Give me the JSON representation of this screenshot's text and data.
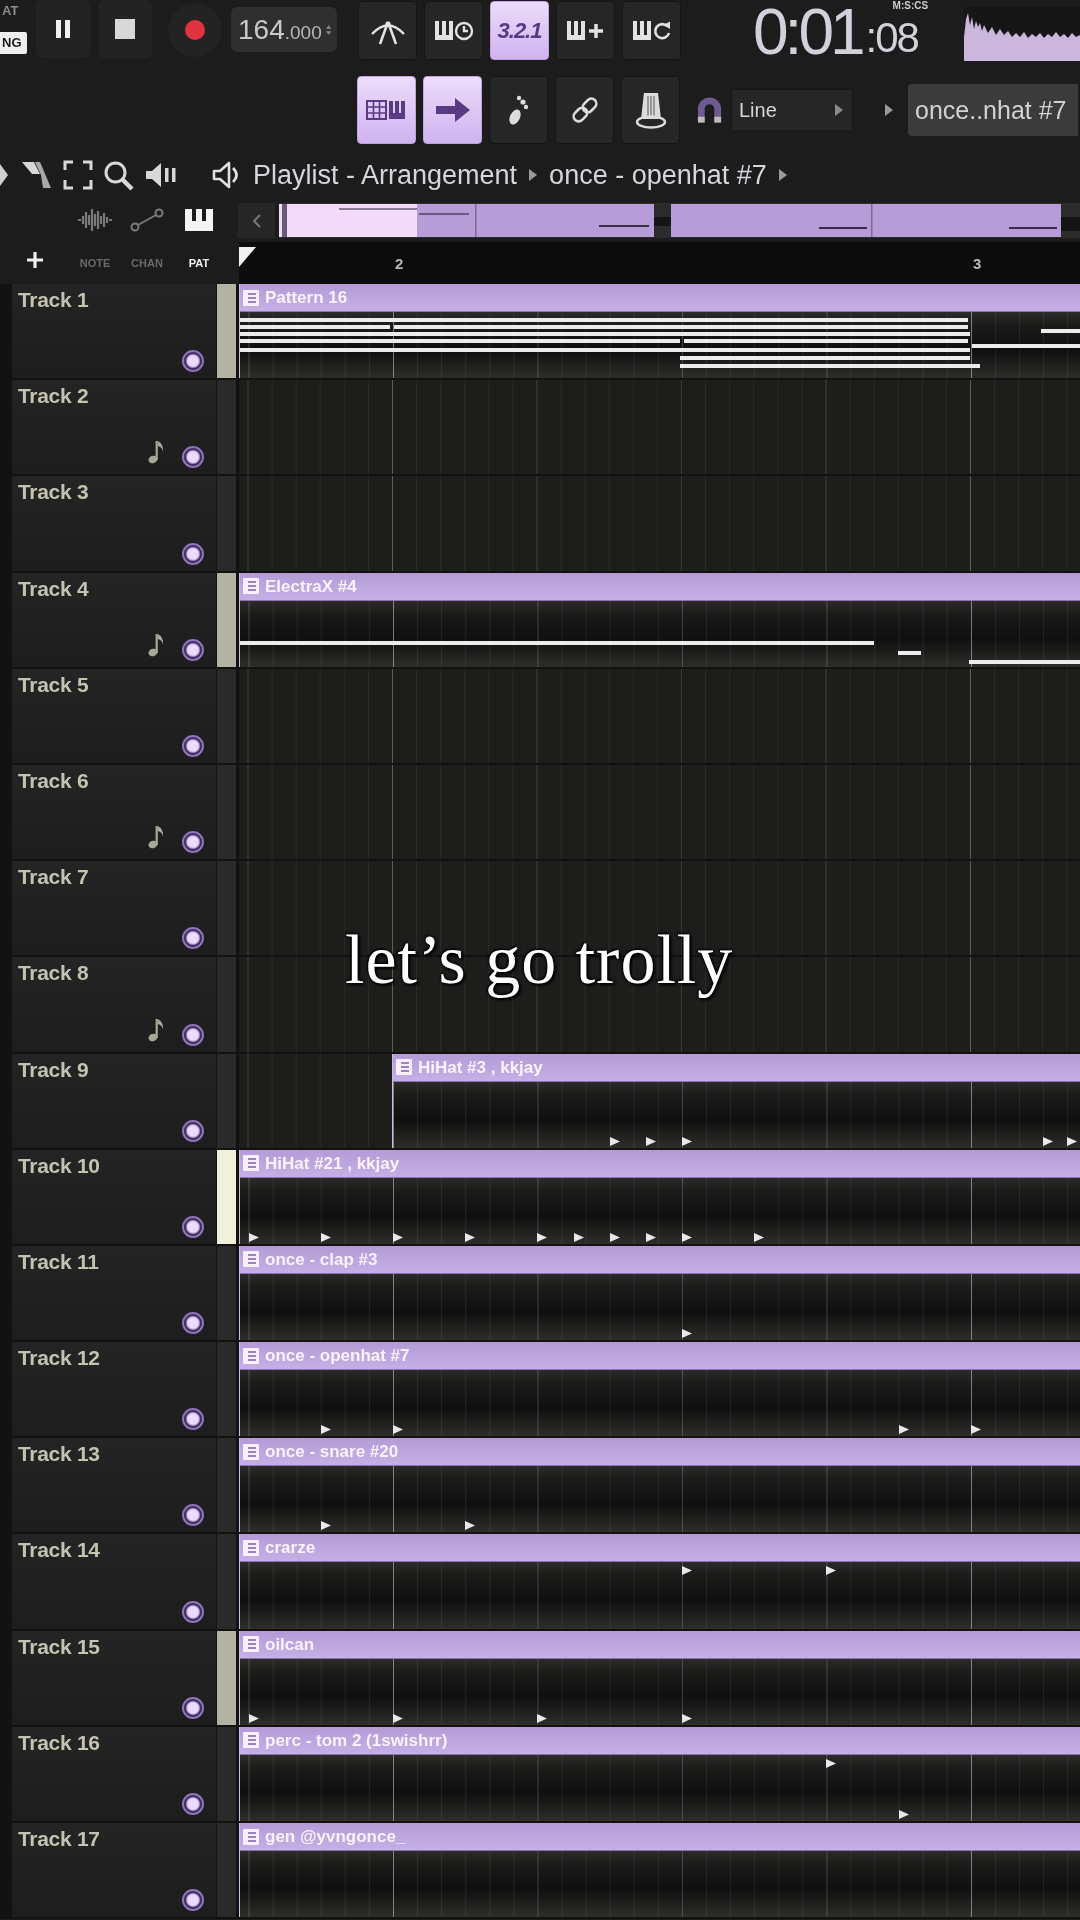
{
  "transport": {
    "modes": [
      {
        "label": "AT",
        "selected": false
      },
      {
        "label": "NG",
        "selected": true
      }
    ],
    "tempo": {
      "whole": "164",
      "fraction": ".000"
    }
  },
  "record_buttons": [
    {
      "kind": "metronome",
      "on": false
    },
    {
      "kind": "wait",
      "on": false
    },
    {
      "kind": "countdown",
      "label": "3.2.1",
      "on": true
    },
    {
      "kind": "blend",
      "on": false
    },
    {
      "kind": "loop",
      "on": false
    }
  ],
  "time": {
    "main": "0:01",
    "fraction": ":08",
    "format": "M:S:CS"
  },
  "tool_buttons": [
    {
      "kind": "piano_roll",
      "on": true
    },
    {
      "kind": "arrow",
      "on": true
    },
    {
      "kind": "foot",
      "on": false
    },
    {
      "kind": "link",
      "on": false
    },
    {
      "kind": "stamp",
      "on": false
    }
  ],
  "snap": {
    "value": "Line"
  },
  "pattern_selector": {
    "value": "once..nhat #7"
  },
  "breadcrumb": [
    "Playlist - Arrangement",
    "once - openhat #7"
  ],
  "filters": [
    {
      "label": "NOTE",
      "kind": "audio",
      "selected": false
    },
    {
      "label": "CHAN",
      "kind": "automation",
      "selected": false
    },
    {
      "label": "PAT",
      "kind": "pattern",
      "selected": true
    }
  ],
  "ruler": {
    "bars": [
      "2",
      "3"
    ]
  },
  "tracks": [
    {
      "name": "Track 1",
      "selected": true,
      "hovered": false,
      "note_icon": false,
      "on": true,
      "clip": {
        "name": "Pattern 16",
        "kind": "notes",
        "at_bar_line": false
      }
    },
    {
      "name": "Track 2",
      "selected": false,
      "hovered": false,
      "note_icon": true,
      "on": true
    },
    {
      "name": "Track 3",
      "selected": false,
      "hovered": false,
      "note_icon": false,
      "on": true
    },
    {
      "name": "Track 4",
      "selected": true,
      "hovered": false,
      "note_icon": true,
      "on": true,
      "clip": {
        "name": "ElectraX #4",
        "kind": "notes",
        "at_bar_line": false
      }
    },
    {
      "name": "Track 5",
      "selected": false,
      "hovered": false,
      "note_icon": false,
      "on": true
    },
    {
      "name": "Track 6",
      "selected": false,
      "hovered": false,
      "note_icon": true,
      "on": true
    },
    {
      "name": "Track 7",
      "selected": false,
      "hovered": false,
      "note_icon": false,
      "on": true
    },
    {
      "name": "Track 8",
      "selected": false,
      "hovered": false,
      "note_icon": true,
      "on": true
    },
    {
      "name": "Track 9",
      "selected": false,
      "hovered": false,
      "note_icon": false,
      "on": true,
      "clip": {
        "name": "HiHat #3 , kkjay",
        "kind": "hits",
        "at_bar_line": true
      }
    },
    {
      "name": "Track 10",
      "selected": true,
      "hovered": true,
      "note_icon": false,
      "on": true,
      "clip": {
        "name": "HiHat #21 , kkjay",
        "kind": "hits",
        "at_bar_line": false
      }
    },
    {
      "name": "Track 11",
      "selected": false,
      "hovered": false,
      "note_icon": false,
      "on": true,
      "clip": {
        "name": "once - clap #3",
        "kind": "hits",
        "at_bar_line": false
      }
    },
    {
      "name": "Track 12",
      "selected": false,
      "hovered": false,
      "note_icon": false,
      "on": true,
      "clip": {
        "name": "once - openhat #7",
        "kind": "hits",
        "at_bar_line": false
      }
    },
    {
      "name": "Track 13",
      "selected": false,
      "hovered": false,
      "note_icon": false,
      "on": true,
      "clip": {
        "name": "once - snare #20",
        "kind": "hits",
        "at_bar_line": false
      }
    },
    {
      "name": "Track 14",
      "selected": false,
      "hovered": false,
      "note_icon": false,
      "on": true,
      "clip": {
        "name": "crarze",
        "kind": "hits",
        "at_bar_line": false
      }
    },
    {
      "name": "Track 15",
      "selected": true,
      "hovered": false,
      "note_icon": false,
      "on": true,
      "clip": {
        "name": "oilcan",
        "kind": "hits",
        "at_bar_line": false
      }
    },
    {
      "name": "Track 16",
      "selected": false,
      "hovered": false,
      "note_icon": false,
      "on": true,
      "clip": {
        "name": "perc - tom 2 (1swishrr)",
        "kind": "hits",
        "at_bar_line": false
      }
    },
    {
      "name": "Track 17",
      "selected": false,
      "hovered": false,
      "note_icon": false,
      "on": true,
      "clip": {
        "name": "gen @yvngonce_",
        "kind": "hits",
        "at_bar_line": false
      }
    }
  ],
  "caption": "let’s go trolly"
}
